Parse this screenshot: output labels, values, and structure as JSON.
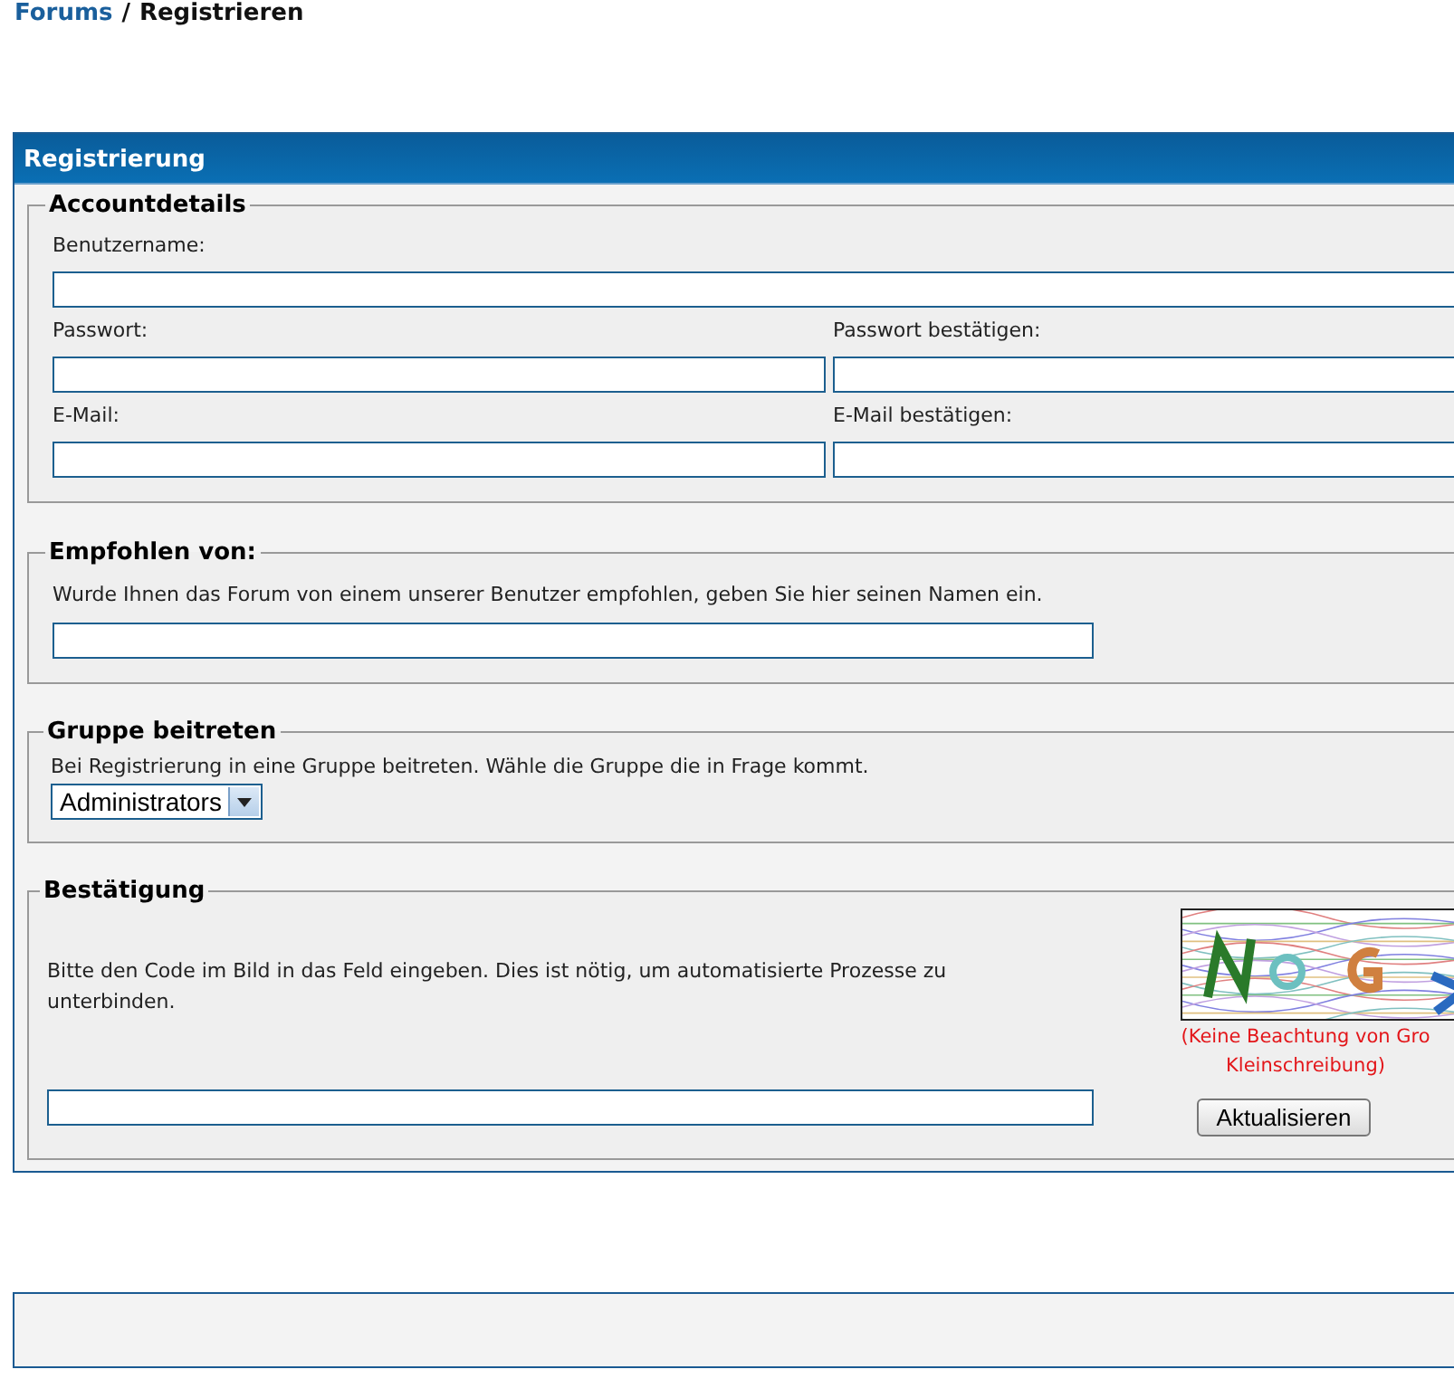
{
  "breadcrumb": {
    "link": "Forums",
    "separator": "/",
    "current": "Registrieren"
  },
  "panel": {
    "title": "Registrierung"
  },
  "account": {
    "legend": "Accountdetails",
    "username": {
      "label": "Benutzername:"
    },
    "pairs": [
      {
        "left": {
          "label": "Passwort:"
        },
        "right": {
          "label": "Passwort bestätigen:"
        }
      },
      {
        "left": {
          "label": "E-Mail:"
        },
        "right": {
          "label": "E-Mail bestätigen:"
        }
      }
    ]
  },
  "referral": {
    "legend": "Empfohlen von:",
    "hint": "Wurde Ihnen das Forum von einem unserer Benutzer empfohlen, geben Sie hier seinen Namen ein."
  },
  "group": {
    "legend": "Gruppe beitreten",
    "hint": "Bei Registrierung in eine Gruppe beitreten. Wähle die Gruppe die in Frage kommt.",
    "select": {
      "value": "Administrators"
    }
  },
  "confirmation": {
    "legend": "Bestätigung",
    "hint": "Bitte den Code im Bild in das Feld eingeben. Dies ist nötig, um automatisierte Prozesse zu unterbinden.",
    "note_lines": [
      "(Keine Beachtung von Gro",
      "Kleinschreibung)"
    ],
    "refresh_button": "Aktualisieren"
  }
}
